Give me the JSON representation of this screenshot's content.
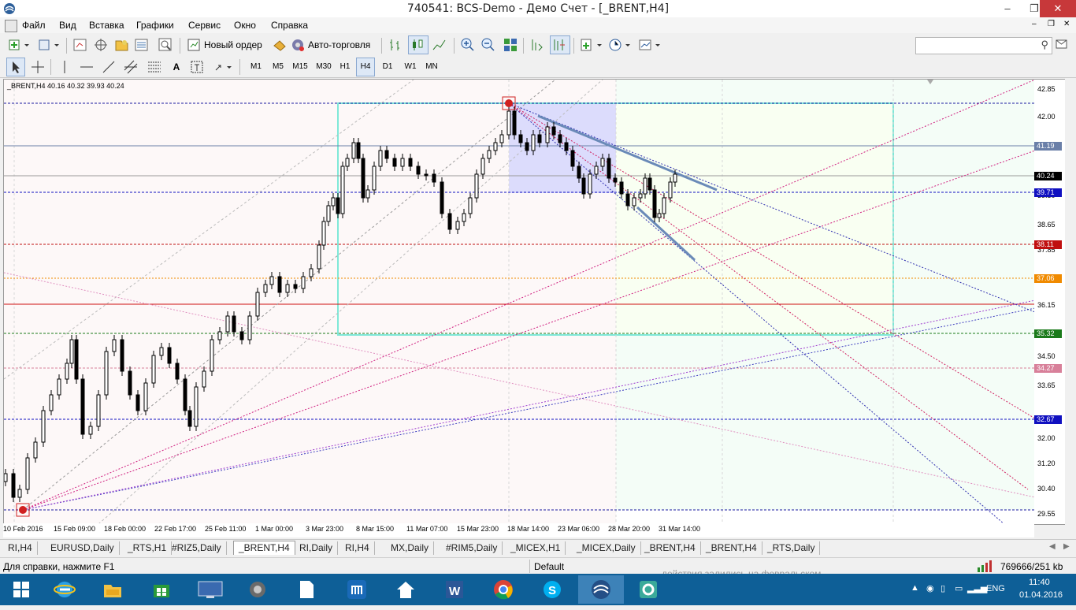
{
  "window": {
    "title": "740541: BCS-Demo - Демо Счет - [_BRENT,H4]",
    "controls": [
      "–",
      "❐",
      "✕"
    ]
  },
  "menu": [
    "Файл",
    "Вид",
    "Вставка",
    "Графики",
    "Сервис",
    "Окно",
    "Справка"
  ],
  "toolbar": {
    "new_order": "Новый ордер",
    "auto_trading": "Авто-торговля",
    "timeframes": [
      "M1",
      "M5",
      "M15",
      "M30",
      "H1",
      "H4",
      "D1",
      "W1",
      "MN"
    ],
    "active_timeframe": "H4"
  },
  "search": {
    "placeholder": ""
  },
  "chart": {
    "header": "_BRENT,H4  40.16 40.32 39.93 40.24",
    "price_labels": [
      "42.85",
      "42.00",
      "41.19",
      "40.24",
      "39.71",
      "39.50",
      "38.65",
      "38.11",
      "37.85",
      "37.06",
      "36.15",
      "35.32",
      "34.50",
      "34.27",
      "33.65",
      "32.67",
      "32.00",
      "31.20",
      "30.40",
      "29.55"
    ],
    "level_tags": [
      {
        "text": "41.19",
        "color": "#6a7fa8"
      },
      {
        "text": "40.24",
        "color": "#000000"
      },
      {
        "text": "39.71",
        "color": "#1010c0"
      },
      {
        "text": "38.11",
        "color": "#c01010"
      },
      {
        "text": "37.06",
        "color": "#f08a00"
      },
      {
        "text": "35.32",
        "color": "#1a7a1a"
      },
      {
        "text": "34.27",
        "color": "#d8809a"
      },
      {
        "text": "32.67",
        "color": "#1010c0"
      }
    ],
    "time_labels": [
      "10 Feb 2016",
      "15 Feb 09:00",
      "18 Feb 00:00",
      "22 Feb 17:00",
      "25 Feb 11:00",
      "1 Mar 00:00",
      "3 Mar 23:00",
      "8 Mar 15:00",
      "11 Mar 07:00",
      "15 Mar 23:00",
      "18 Mar 14:00",
      "23 Mar 06:00",
      "28 Mar 20:00",
      "31 Mar 14:00"
    ]
  },
  "tabs": [
    "RI,H4",
    "EURUSD,Daily",
    "_RTS,H1",
    "#RIZ5,Daily",
    "_BRENT,H4",
    "RI,Daily",
    "RI,H4",
    "MX,Daily",
    "#RIM5,Daily",
    "_MICEX,H1",
    "_MICEX,Daily",
    "_BRENT,H4",
    "_BRENT,H4",
    "_RTS,Daily"
  ],
  "active_tab_index": 4,
  "status": {
    "help": "Для справки, нажмите F1",
    "profile": "Default",
    "traffic": "769666/251 kb",
    "ghost": "действия залились на февральском"
  },
  "taskbar": {
    "lang": "ENG",
    "time": "11:40",
    "date": "01.04.2016"
  },
  "colors": {
    "taskbar": "#0e5f97",
    "close": "#c7383a",
    "cyan_box": "#7fe8d8"
  }
}
